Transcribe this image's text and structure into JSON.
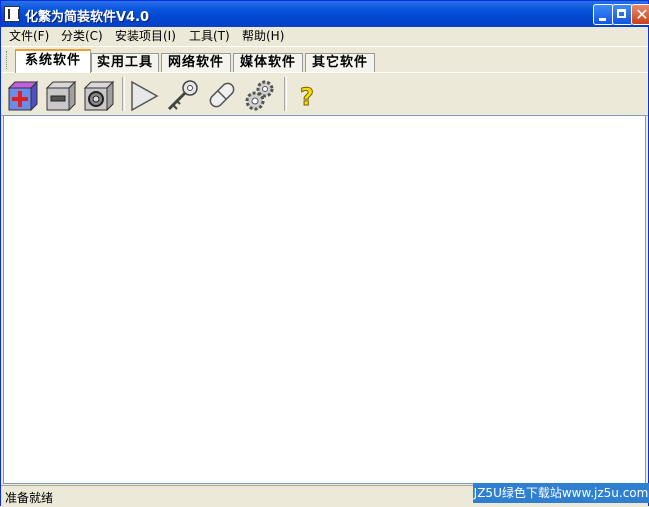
{
  "window": {
    "title": "化繁为简装软件V4.0"
  },
  "menu": [
    {
      "label": "文件(F)"
    },
    {
      "label": "分类(C)"
    },
    {
      "label": "安装项目(I)"
    },
    {
      "label": "工具(T)"
    },
    {
      "label": "帮助(H)"
    }
  ],
  "tabs": [
    {
      "label": "系统软件",
      "active": true
    },
    {
      "label": "实用工具",
      "active": false
    },
    {
      "label": "网络软件",
      "active": false
    },
    {
      "label": "媒体软件",
      "active": false
    },
    {
      "label": "其它软件",
      "active": false
    }
  ],
  "toolbar": {
    "icons": [
      "add-cube-icon",
      "remove-cube-icon",
      "properties-cube-icon",
      "play-icon",
      "key-icon",
      "pill-icon",
      "gears-icon",
      "help-question-icon"
    ]
  },
  "status": {
    "text": "准备就绪"
  },
  "watermark": {
    "text": "JZ5U绿色下载站www.jz5u.com"
  },
  "colors": {
    "titlebar": "#0a58e0",
    "tab_active_accent": "#f0a030",
    "watermark_bg": "#2e7fcf"
  }
}
